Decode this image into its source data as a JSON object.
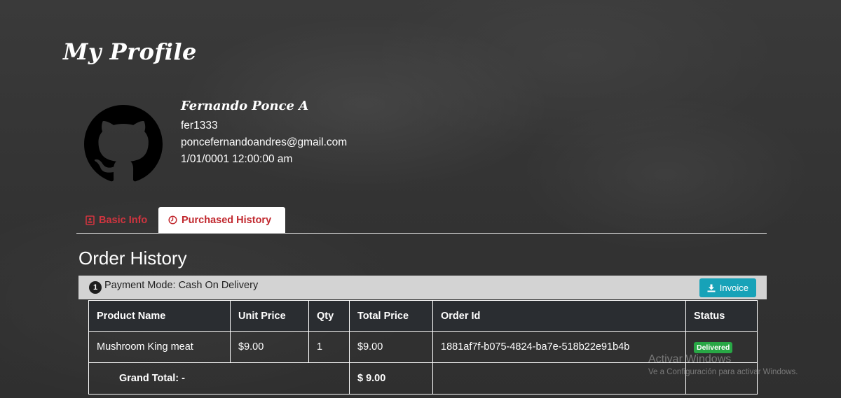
{
  "page": {
    "title": "My Profile"
  },
  "profile": {
    "name": "Fernando Ponce A",
    "username": "fer1333",
    "email": "poncefernandoandres@gmail.com",
    "date": "1/01/0001 12:00:00 am",
    "avatar_icon": "github-icon"
  },
  "tabs": [
    {
      "label": "Basic Info",
      "icon": "id-card-icon",
      "active": false
    },
    {
      "label": "Purchased History",
      "icon": "clock-icon",
      "active": true
    }
  ],
  "order_history": {
    "title": "Order History",
    "orders": [
      {
        "number": "1",
        "payment_mode": "Payment Mode: Cash On Delivery",
        "invoice_label": "Invoice",
        "columns": [
          "Product Name",
          "Unit Price",
          "Qty",
          "Total Price",
          "Order Id",
          "Status"
        ],
        "items": [
          {
            "product": "Mushroom King meat",
            "unit_price": "$9.00",
            "qty": "1",
            "total": "$9.00",
            "order_id": "1881af7f-b075-4824-ba7e-518b22e91b4b",
            "status": "Delivered"
          }
        ],
        "grand_total_label": "Grand Total: -",
        "grand_total_value": "$ 9.00"
      }
    ]
  },
  "watermark": {
    "title": "Activar Windows",
    "subtitle": "Ve a Configuración para activar Windows."
  },
  "colors": {
    "background": "#333333",
    "tab_active_text": "#c1272d",
    "tab_inactive_text": "#d0343f",
    "invoice_button": "#17a2b8",
    "status_delivered": "#28a745",
    "table_header": "#2a2d31"
  }
}
